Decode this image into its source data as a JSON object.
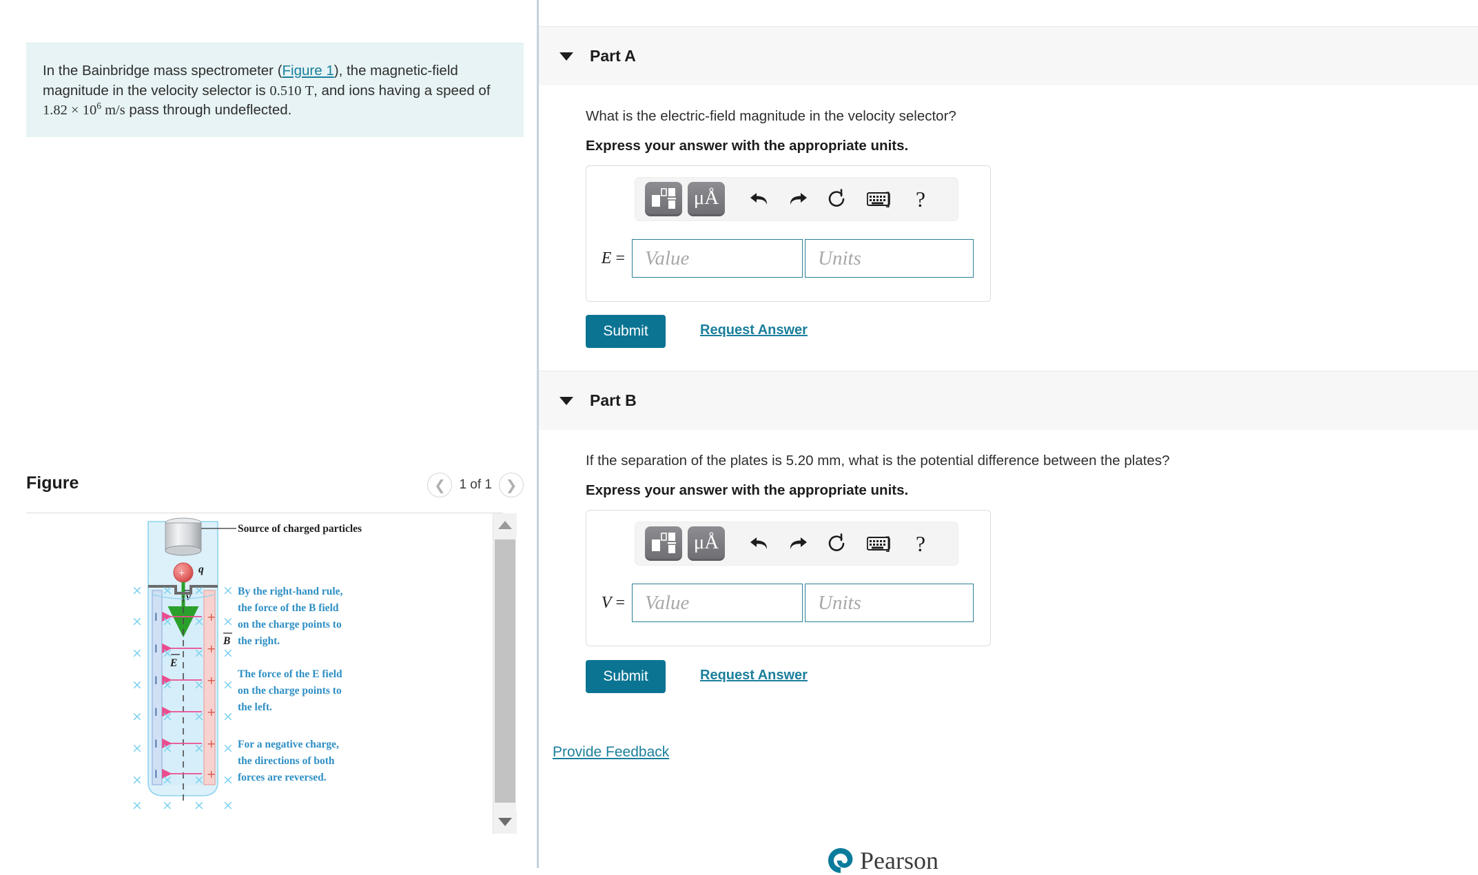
{
  "problem": {
    "text_before_link": "In the Bainbridge mass spectrometer (",
    "figure_link": "Figure 1",
    "text_after_link_1": "), the magnetic-field magnitude in the velocity selector is ",
    "field_value": "0.510",
    "field_unit": "T",
    "text_after_link_2": ", and ions having a speed of ",
    "speed_mantissa": "1.82",
    "speed_times": "×",
    "speed_base": "10",
    "speed_exponent": "6",
    "speed_unit": "m/s",
    "text_end": " pass through undeflected.",
    "background_color": "#e7f3f4"
  },
  "figure": {
    "title": "Figure",
    "counter": "1 of 1",
    "prev_icon": "chevron-left-icon",
    "next_icon": "chevron-right-icon",
    "caption_source": "Source of charged particles",
    "charge_label": "q",
    "velocity_label": "v",
    "b_field_label": "B",
    "e_field_label": "E",
    "note_1_line_1": "By the right-hand rule,",
    "note_1_line_2": "the force of the B field",
    "note_1_line_3": "on the charge points to",
    "note_1_line_4": "the right.",
    "note_2_line_1": "The force of the E field",
    "note_2_line_2": "on the charge points to",
    "note_2_line_3": "the left.",
    "note_3_line_1": "For a negative charge,",
    "note_3_line_2": "the directions of both",
    "note_3_line_3": "forces are reversed.",
    "plus_sign": "+",
    "minus_sign": "I",
    "cross_glyph": "×",
    "note_color": "#2e8fc4"
  },
  "parts": [
    {
      "id": "A",
      "title": "Part A",
      "caret_icon": "caret-down-icon",
      "question": "What is the electric-field magnitude in the velocity selector?",
      "instruction": "Express your answer with the appropriate units.",
      "answer_symbol": "E",
      "equals": "=",
      "value_placeholder": "Value",
      "units_placeholder": "Units",
      "value_current": "",
      "units_current": "",
      "submit_label": "Submit",
      "request_label": "Request Answer",
      "toolbar": {
        "template_icon": "math-template-icon",
        "units_label": "μÅ",
        "units_icon": "units-icon",
        "undo_icon": "undo-arrow-icon",
        "redo_icon": "redo-arrow-icon",
        "reset_icon": "reset-circular-arrow-icon",
        "keyboard_icon": "keyboard-icon",
        "bracket_label": "]",
        "help_label": "?"
      }
    },
    {
      "id": "B",
      "title": "Part B",
      "caret_icon": "caret-down-icon",
      "question": "If the separation of the plates is 5.20 mm, what is the potential difference between the plates?",
      "instruction": "Express your answer with the appropriate units.",
      "answer_symbol": "V",
      "equals": "=",
      "value_placeholder": "Value",
      "units_placeholder": "Units",
      "value_current": "",
      "units_current": "",
      "submit_label": "Submit",
      "request_label": "Request Answer",
      "toolbar": {
        "template_icon": "math-template-icon",
        "units_label": "μÅ",
        "units_icon": "units-icon",
        "undo_icon": "undo-arrow-icon",
        "redo_icon": "redo-arrow-icon",
        "reset_icon": "reset-circular-arrow-icon",
        "keyboard_icon": "keyboard-icon",
        "bracket_label": "]",
        "help_label": "?"
      }
    }
  ],
  "footer": {
    "provide_feedback": "Provide Feedback",
    "brand": "Pearson",
    "brand_color": "#0b7b9c"
  },
  "scrollbar": {
    "up_icon": "scroll-up-arrow-icon",
    "down_icon": "scroll-down-arrow-icon",
    "thumb": "scrollbar-thumb"
  },
  "colors": {
    "accent_teal": "#0b7493",
    "link_teal": "#1a7f9c",
    "field_border": "#2a7f95",
    "panel_gray": "#f7f7f7"
  }
}
